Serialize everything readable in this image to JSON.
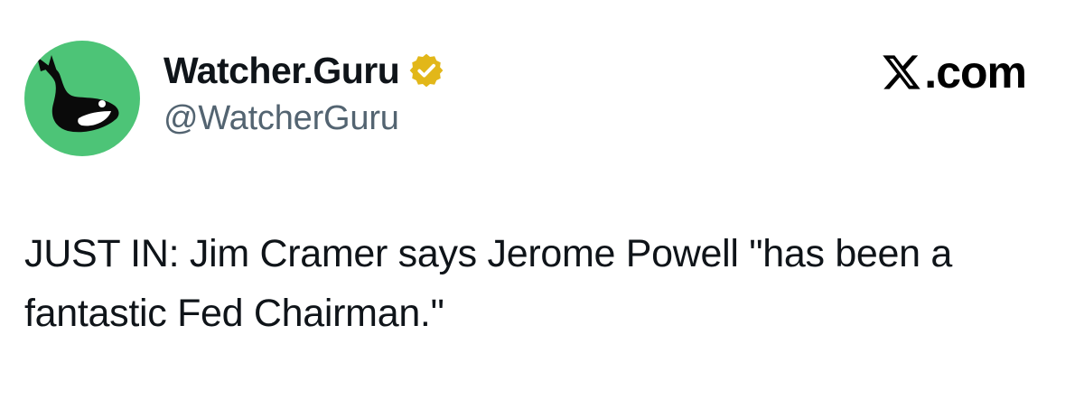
{
  "account": {
    "display_name": "Watcher.Guru",
    "handle": "@WatcherGuru",
    "verified": true,
    "avatar_icon": "whale-logo-icon",
    "avatar_color": "#4dc477",
    "verified_badge_color": "#e2b719"
  },
  "brand": {
    "logo_icon": "x-logo-icon",
    "domain_suffix": ".com"
  },
  "tweet": {
    "text": "JUST IN: Jim Cramer says Jerome Powell \"has been a fantastic Fed Chairman.\""
  }
}
